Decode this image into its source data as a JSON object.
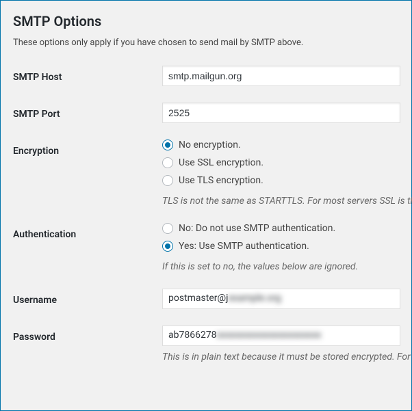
{
  "heading": "SMTP Options",
  "description": "These options only apply if you have chosen to send mail by SMTP above.",
  "smtp_host": {
    "label": "SMTP Host",
    "value": "smtp.mailgun.org"
  },
  "smtp_port": {
    "label": "SMTP Port",
    "value": "2525"
  },
  "encryption": {
    "label": "Encryption",
    "options": {
      "none": "No encryption.",
      "ssl": "Use SSL encryption.",
      "tls": "Use TLS encryption."
    },
    "selected": "none",
    "help": "TLS is not the same as STARTTLS. For most servers SSL is the r"
  },
  "authentication": {
    "label": "Authentication",
    "options": {
      "no": "No: Do not use SMTP authentication.",
      "yes": "Yes: Use SMTP authentication."
    },
    "selected": "yes",
    "help": "If this is set to no, the values below are ignored."
  },
  "username": {
    "label": "Username",
    "value_visible": "postmaster@j",
    "value_blurred": "example.org"
  },
  "password": {
    "label": "Password",
    "value_visible": "ab7866278",
    "value_blurred": "xxxxxxxxxxxxxxxxxxxxxx",
    "help": "This is in plain text because it must be stored encrypted. For r"
  }
}
